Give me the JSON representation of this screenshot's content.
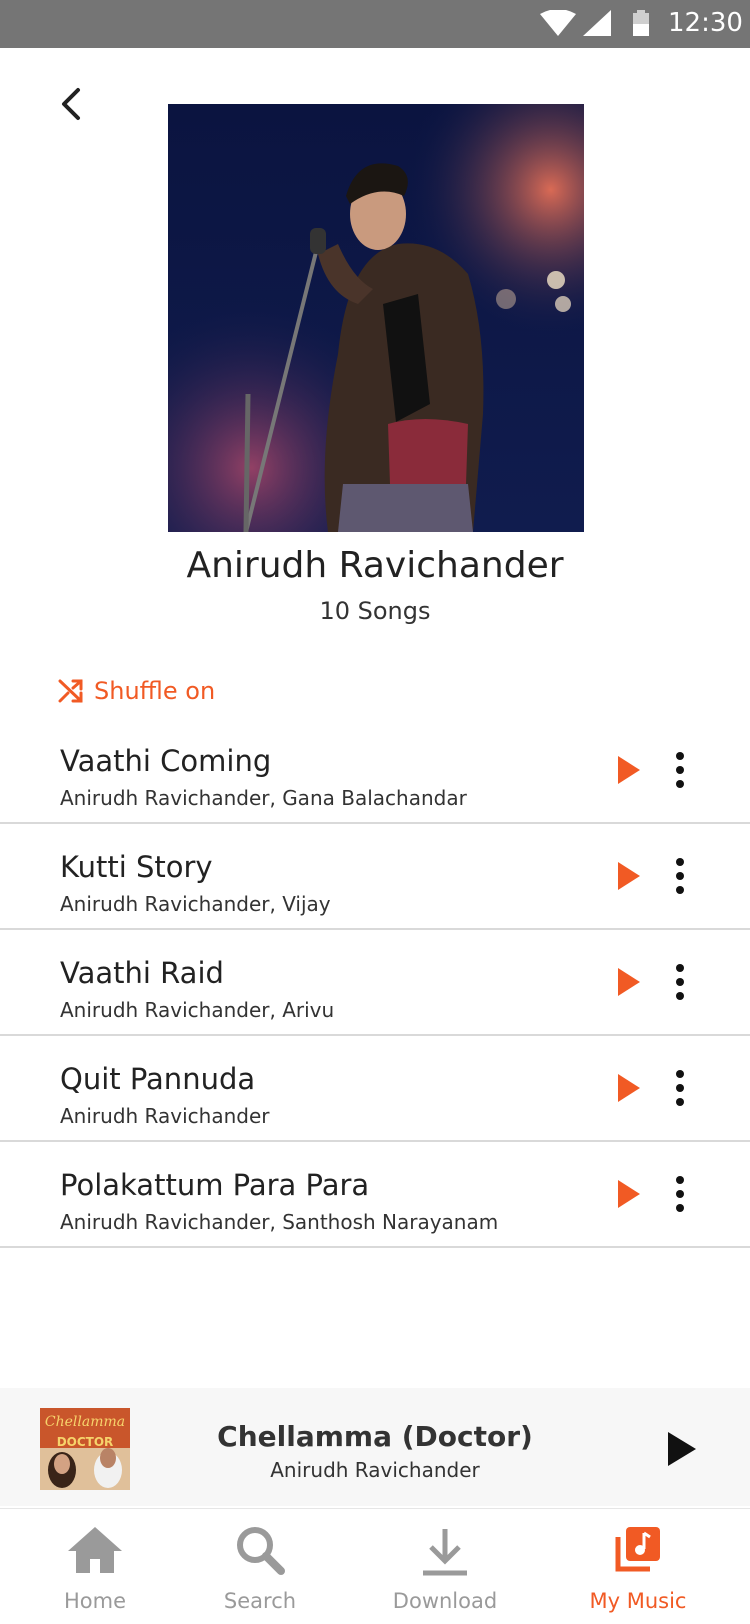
{
  "status_bar": {
    "time": "12:30"
  },
  "colors": {
    "accent": "#f15a24",
    "status_bar": "#757575",
    "nav_inactive": "#9a9a9a"
  },
  "header": {
    "back_icon": "chevron-left-icon",
    "artist_name": "Anirudh Ravichander",
    "song_count": "10 Songs"
  },
  "shuffle": {
    "icon": "shuffle-icon",
    "label": "Shuffle on"
  },
  "songs": [
    {
      "title": "Vaathi Coming",
      "artists": "Anirudh Ravichander, Gana Balachandar"
    },
    {
      "title": "Kutti Story",
      "artists": "Anirudh Ravichander, Vijay"
    },
    {
      "title": "Vaathi Raid",
      "artists": "Anirudh Ravichander, Arivu"
    },
    {
      "title": "Quit Pannuda",
      "artists": "Anirudh Ravichander"
    },
    {
      "title": "Polakattum Para Para",
      "artists": "Anirudh Ravichander, Santhosh Narayanam"
    }
  ],
  "mini_player": {
    "title": "Chellamma (Doctor)",
    "artist": "Anirudh Ravichander",
    "thumb_title": "Chellamma",
    "thumb_subtitle": "DOCTOR"
  },
  "nav": {
    "items": [
      {
        "label": "Home",
        "icon": "home-icon"
      },
      {
        "label": "Search",
        "icon": "search-icon"
      },
      {
        "label": "Download",
        "icon": "download-icon"
      },
      {
        "label": "My Music",
        "icon": "my-music-icon"
      }
    ],
    "active": "My Music"
  }
}
